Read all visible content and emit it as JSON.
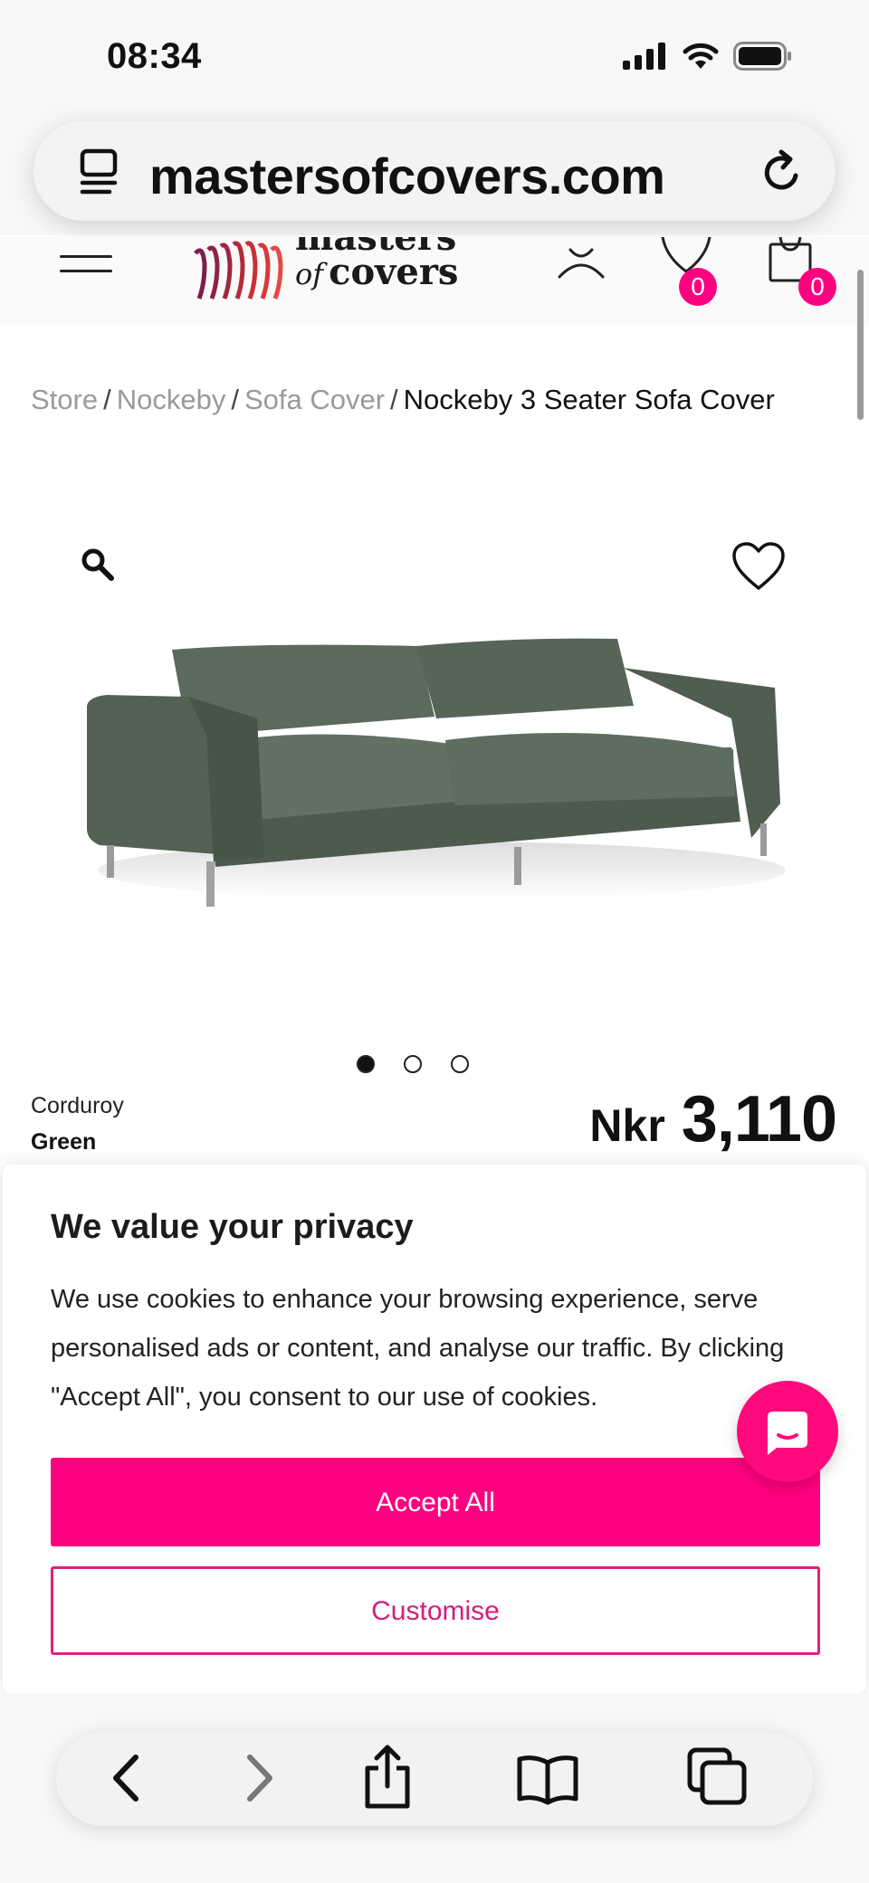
{
  "status_bar": {
    "time": "08:34"
  },
  "browser": {
    "url": "mastersofcovers.com"
  },
  "header": {
    "logo_line1": "masters",
    "logo_of": "of",
    "logo_line2": "covers",
    "wishlist_count": "0",
    "cart_count": "0"
  },
  "breadcrumb": {
    "items": [
      "Store",
      "Nockeby",
      "Sofa Cover"
    ],
    "separator": "/",
    "current": "Nockeby 3 Seater Sofa Cover"
  },
  "product": {
    "image_alt": "Green corduroy Nockeby 3 seater sofa",
    "material": "Corduroy",
    "color": "Green",
    "currency": "Nkr",
    "price": "3,110",
    "gallery_count": 3,
    "gallery_active": 1,
    "fabric_color": "#5a6b5c"
  },
  "cookie_banner": {
    "title": "We value your privacy",
    "body": "We use cookies to enhance your browsing experience, serve personalised ads or content, and analyse our traffic. By clicking \"Accept All\", you consent to our use of cookies.",
    "accept_label": "Accept All",
    "customise_label": "Customise"
  },
  "colors": {
    "accent": "#ff0080",
    "outline": "#e0207e"
  },
  "icons": {
    "toolbar": [
      "back-icon",
      "forward-icon",
      "share-icon",
      "bookmarks-icon",
      "tabs-icon"
    ]
  }
}
